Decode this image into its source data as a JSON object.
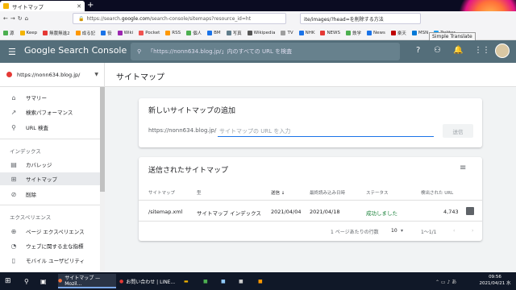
{
  "browser": {
    "tab_title": "サイトマップ",
    "new_tab": "+",
    "url_prefix": "https://search.",
    "url_domain": "google.com",
    "url_rest": "/search-console/sitemaps?resource_id=ht",
    "search_text": "ite/images/?head=を削除する方法",
    "tooltip": "Simple Translate",
    "bookmarks": [
      "源",
      "Keep",
      "無農無進2",
      "成る記",
      "役",
      "Wiki",
      "Pocket",
      "RSS",
      "個人",
      "BM",
      "写真",
      "Wikipedia",
      "TV",
      "NHK",
      "NEWS",
      "鉄学",
      "News",
      "楽天",
      "MSN",
      "Twitter"
    ]
  },
  "header": {
    "brand": "Google Search Console",
    "search_placeholder": "「https://nonn634.blog.jp/」内のすべての URL を検査"
  },
  "sidebar": {
    "property": "https://nonn634.blog.jp/",
    "items_top": [
      {
        "label": "サマリー",
        "icon": "home-icon"
      },
      {
        "label": "検索パフォーマンス",
        "icon": "trend-icon"
      },
      {
        "label": "URL 検査",
        "icon": "search-icon"
      }
    ],
    "index_header": "インデックス",
    "items_index": [
      {
        "label": "カバレッジ",
        "icon": "coverage-icon"
      },
      {
        "label": "サイトマップ",
        "icon": "sitemap-icon",
        "active": true
      },
      {
        "label": "削除",
        "icon": "removal-icon"
      }
    ],
    "experience_header": "エクスペリエンス",
    "items_experience": [
      {
        "label": "ページ エクスペリエンス",
        "icon": "plus-circle-icon"
      },
      {
        "label": "ウェブに関する主な指標",
        "icon": "speed-icon"
      },
      {
        "label": "モバイル ユーザビリティ",
        "icon": "mobile-icon"
      }
    ]
  },
  "main": {
    "page_title": "サイトマップ",
    "add_card": {
      "title": "新しいサイトマップの追加",
      "prefix": "https://nonn634.blog.jp/",
      "input_placeholder": "サイトマップの URL を入力",
      "submit": "送信"
    },
    "submitted_card": {
      "title": "送信されたサイトマップ",
      "columns": [
        "サイトマップ",
        "型",
        "送信 ↓",
        "最終読み込み日時",
        "ステータス",
        "検出された URL"
      ],
      "rows": [
        {
          "sitemap": "/sitemap.xml",
          "type": "サイトマップ インデックス",
          "submitted": "2021/04/04",
          "last_read": "2021/04/18",
          "status": "成功しました",
          "urls": "4,743"
        }
      ],
      "rows_per_page_label": "1 ページあたりの行数",
      "rows_per_page": "10",
      "range": "1〜1/1"
    },
    "status_color": "#188038"
  },
  "taskbar": {
    "item1": "サイトマップ — Mozil...",
    "item2": "お問い合わせ | LINE...",
    "time": "09:56",
    "date": "2021/04/21 水"
  }
}
